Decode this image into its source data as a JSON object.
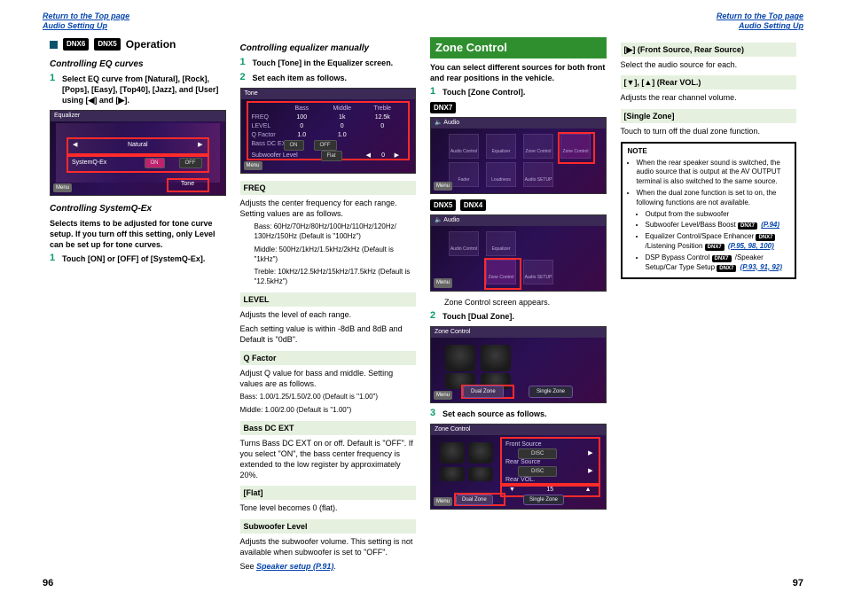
{
  "hdr": {
    "top": "Return to the Top page",
    "aud": "Audio Setting Up"
  },
  "pagenums": {
    "left": "96",
    "right": "97"
  },
  "col1": {
    "chips": {
      "a": "DNX6",
      "b": "DNX5"
    },
    "op": "Operation",
    "eqcurves": "Controlling EQ curves",
    "eqcurves_step": "Select EQ curve from [Natural], [Rock], [Pops], [Easy], [Top40], [Jazz], and [User] using [◀] and [▶].",
    "shot1": {
      "title": "Equalizer",
      "natural": "Natural",
      "sysq": "SystemQ-Ex",
      "on": "ON",
      "off": "OFF",
      "tone": "Tone",
      "menu": "Menu"
    },
    "sysqex": "Controlling SystemQ-Ex",
    "sysqex_desc": "Selects items to be adjusted for tone curve setup. If you turn off this setting, only Level can be set up for tone curves.",
    "sysqex_step": "Touch [ON] or [OFF] of [SystemQ-Ex]."
  },
  "col2": {
    "man": "Controlling equalizer manually",
    "s1": "Touch [Tone] in the Equalizer screen.",
    "s2": "Set each item as follows.",
    "shot": {
      "title": "Tone",
      "bass": "Bass",
      "mid": "Middle",
      "tre": "Treble",
      "freq": "FREQ",
      "lvl": "LEVEL",
      "qf": "Q Factor",
      "dcx": "Bass DC EXT",
      "flat": "Flat",
      "sub": "Subwoofer Level",
      "on": "ON",
      "off": "OFF",
      "f1": "100",
      "f2": "1k",
      "f3": "12.5k",
      "l": "0",
      "q": "1.0",
      "s": "0",
      "menu": "Menu"
    },
    "freq_h": "FREQ",
    "freq_t": "Adjusts the center frequency for each range. Setting values are as follows.",
    "freq_b": "Bass: 60Hz/70Hz/80Hz/100Hz/110Hz/120Hz/ 130Hz/150Hz (Default is \"100Hz\")",
    "freq_m": "Middle: 500Hz/1kHz/1.5kHz/2kHz (Default is \"1kHz\")",
    "freq_tr": "Treble: 10kHz/12.5kHz/15kHz/17.5kHz (Default is \"12.5kHz\")",
    "lvl_h": "LEVEL",
    "lvl_t1": "Adjusts the level of each range.",
    "lvl_t2": "Each setting value is within -8dB and 8dB and Default is \"0dB\".",
    "qf_h": "Q Factor",
    "qf_t": "Adjust Q value for bass and middle. Setting values are as follows.",
    "qf_b": "Bass: 1.00/1.25/1.50/2.00 (Default is \"1.00\")",
    "qf_m": "Middle: 1.00/2.00 (Default is \"1.00\")",
    "dcx_h": "Bass DC EXT",
    "dcx_t": "Turns Bass DC EXT on or off. Default is \"OFF\". If you select \"ON\", the bass center frequency is extended to the low register by approximately 20%.",
    "flat_h": "[Flat]",
    "flat_t": "Tone level becomes 0 (flat).",
    "sub_h": "Subwoofer Level",
    "sub_t": "Adjusts the subwoofer volume. This setting is not available when subwoofer is set to \"OFF\".",
    "sub_see_a": "See ",
    "sub_see_b": "Speaker setup (P.91)",
    "sub_see_c": "."
  },
  "col3": {
    "zone": "Zone Control",
    "intro": "You can select different sources for both front and rear positions in the vehicle.",
    "s1": "Touch [Zone Control].",
    "chip7": "DNX7",
    "chip5": "DNX5",
    "chip4": "DNX4",
    "grid": {
      "title": "Audio",
      "ac": "Audio Control",
      "eq": "Equalizer",
      "zc": "Zone Control",
      "fa": "Fader",
      "ls": "Loudness",
      "as": "Audio SETUP",
      "menu": "Menu"
    },
    "after": "Zone Control screen appears.",
    "s2": "Touch [Dual Zone].",
    "shot2": {
      "title": "Zone Control",
      "dual": "Dual Zone",
      "single": "Single Zone",
      "menu": "Menu"
    },
    "s3": "Set each source as follows.",
    "shot3": {
      "title": "Zone Control",
      "fs": "Front Source",
      "rs": "Rear Source",
      "rv": "Rear VOL.",
      "disc": "DISC",
      "v": "15",
      "dual": "Dual Zone",
      "single": "Single Zone",
      "menu": "Menu"
    }
  },
  "col4": {
    "h1": "[▶] (Front Source, Rear Source)",
    "t1": "Select the audio source for each.",
    "h2": "[▼], [▲] (Rear VOL.)",
    "t2": "Adjusts the rear channel volume.",
    "h3": "[Single Zone]",
    "t3": "Touch to turn off the dual zone function.",
    "note_h": "NOTE",
    "n1": "When the rear speaker sound is switched, the audio source that is output at the AV OUTPUT terminal is also switched to the same source.",
    "n2": "When the dual zone function is set to on, the following functions are not available.",
    "n2a": "Output from the subwoofer",
    "n2b_a": "Subwoofer Level/Bass Boost ",
    "n2b_chip": "DNX7",
    "n2b_link": "(P.94)",
    "n2c_a": "Equalizer Control/Space Enhancer ",
    "n2c_chip": "DNX7",
    "n2c_b": " /Listening Position ",
    "n2c_chip2": "DNX7",
    "n2c_link": "(P.95, 98, 100)",
    "n2d_a": "DSP Bypass Control ",
    "n2d_chip": "DNX7",
    "n2d_b": " /Speaker Setup/Car Type Setup ",
    "n2d_chip2": "DNX7",
    "n2d_link": "(P.93, 91, 92)"
  }
}
